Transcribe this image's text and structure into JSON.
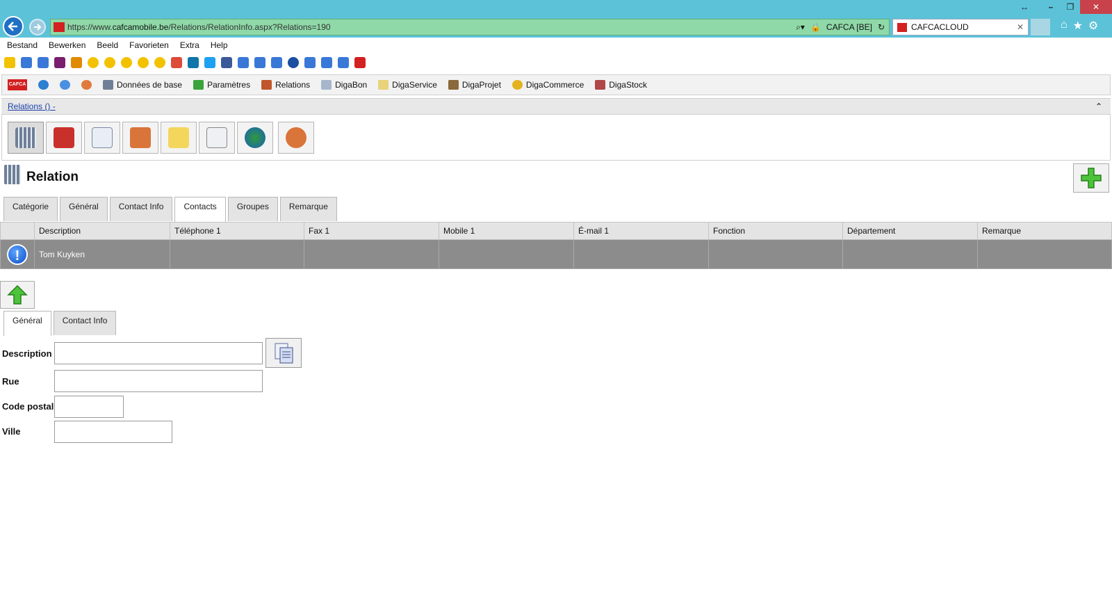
{
  "browser": {
    "url_prefix": "https://www.",
    "url_domain": "cafcamobile.be",
    "url_path": "/Relations/RelationInfo.aspx?Relations=190",
    "site_identity": "CAFCA [BE]",
    "tab_title": "CAFCACLOUD",
    "menu": [
      "Bestand",
      "Bewerken",
      "Beeld",
      "Favorieten",
      "Extra",
      "Help"
    ]
  },
  "app_toolbar": {
    "logo_text": "CAFCA",
    "items": [
      "Données de base",
      "Paramètres",
      "Relations",
      "DigaBon",
      "DigaService",
      "DigaProjet",
      "DigaCommerce",
      "DigaStock"
    ]
  },
  "breadcrumb": {
    "link": "Relations () -"
  },
  "page": {
    "title": "Relation"
  },
  "tabs": [
    "Catégorie",
    "Général",
    "Contact Info",
    "Contacts",
    "Groupes",
    "Remarque"
  ],
  "active_tab": "Contacts",
  "contacts_grid": {
    "columns": [
      "Description",
      "Téléphone 1",
      "Fax 1",
      "Mobile 1",
      "É-mail 1",
      "Fonction",
      "Département",
      "Remarque"
    ],
    "rows": [
      {
        "description": "Tom Kuyken",
        "telephone": "",
        "fax": "",
        "mobile": "",
        "email": "",
        "fonction": "",
        "departement": "",
        "remarque": ""
      }
    ]
  },
  "subtabs": [
    "Général",
    "Contact Info"
  ],
  "form": {
    "description_label": "Description",
    "rue_label": "Rue",
    "code_postal_label": "Code postal",
    "ville_label": "Ville",
    "description_value": "",
    "rue_value": "",
    "code_postal_value": "",
    "ville_value": ""
  },
  "colors": {
    "chrome": "#5cc2d8",
    "urlbar": "#8fd9a8",
    "selected_row": "#8c8c8c",
    "link": "#1a3fa8"
  }
}
